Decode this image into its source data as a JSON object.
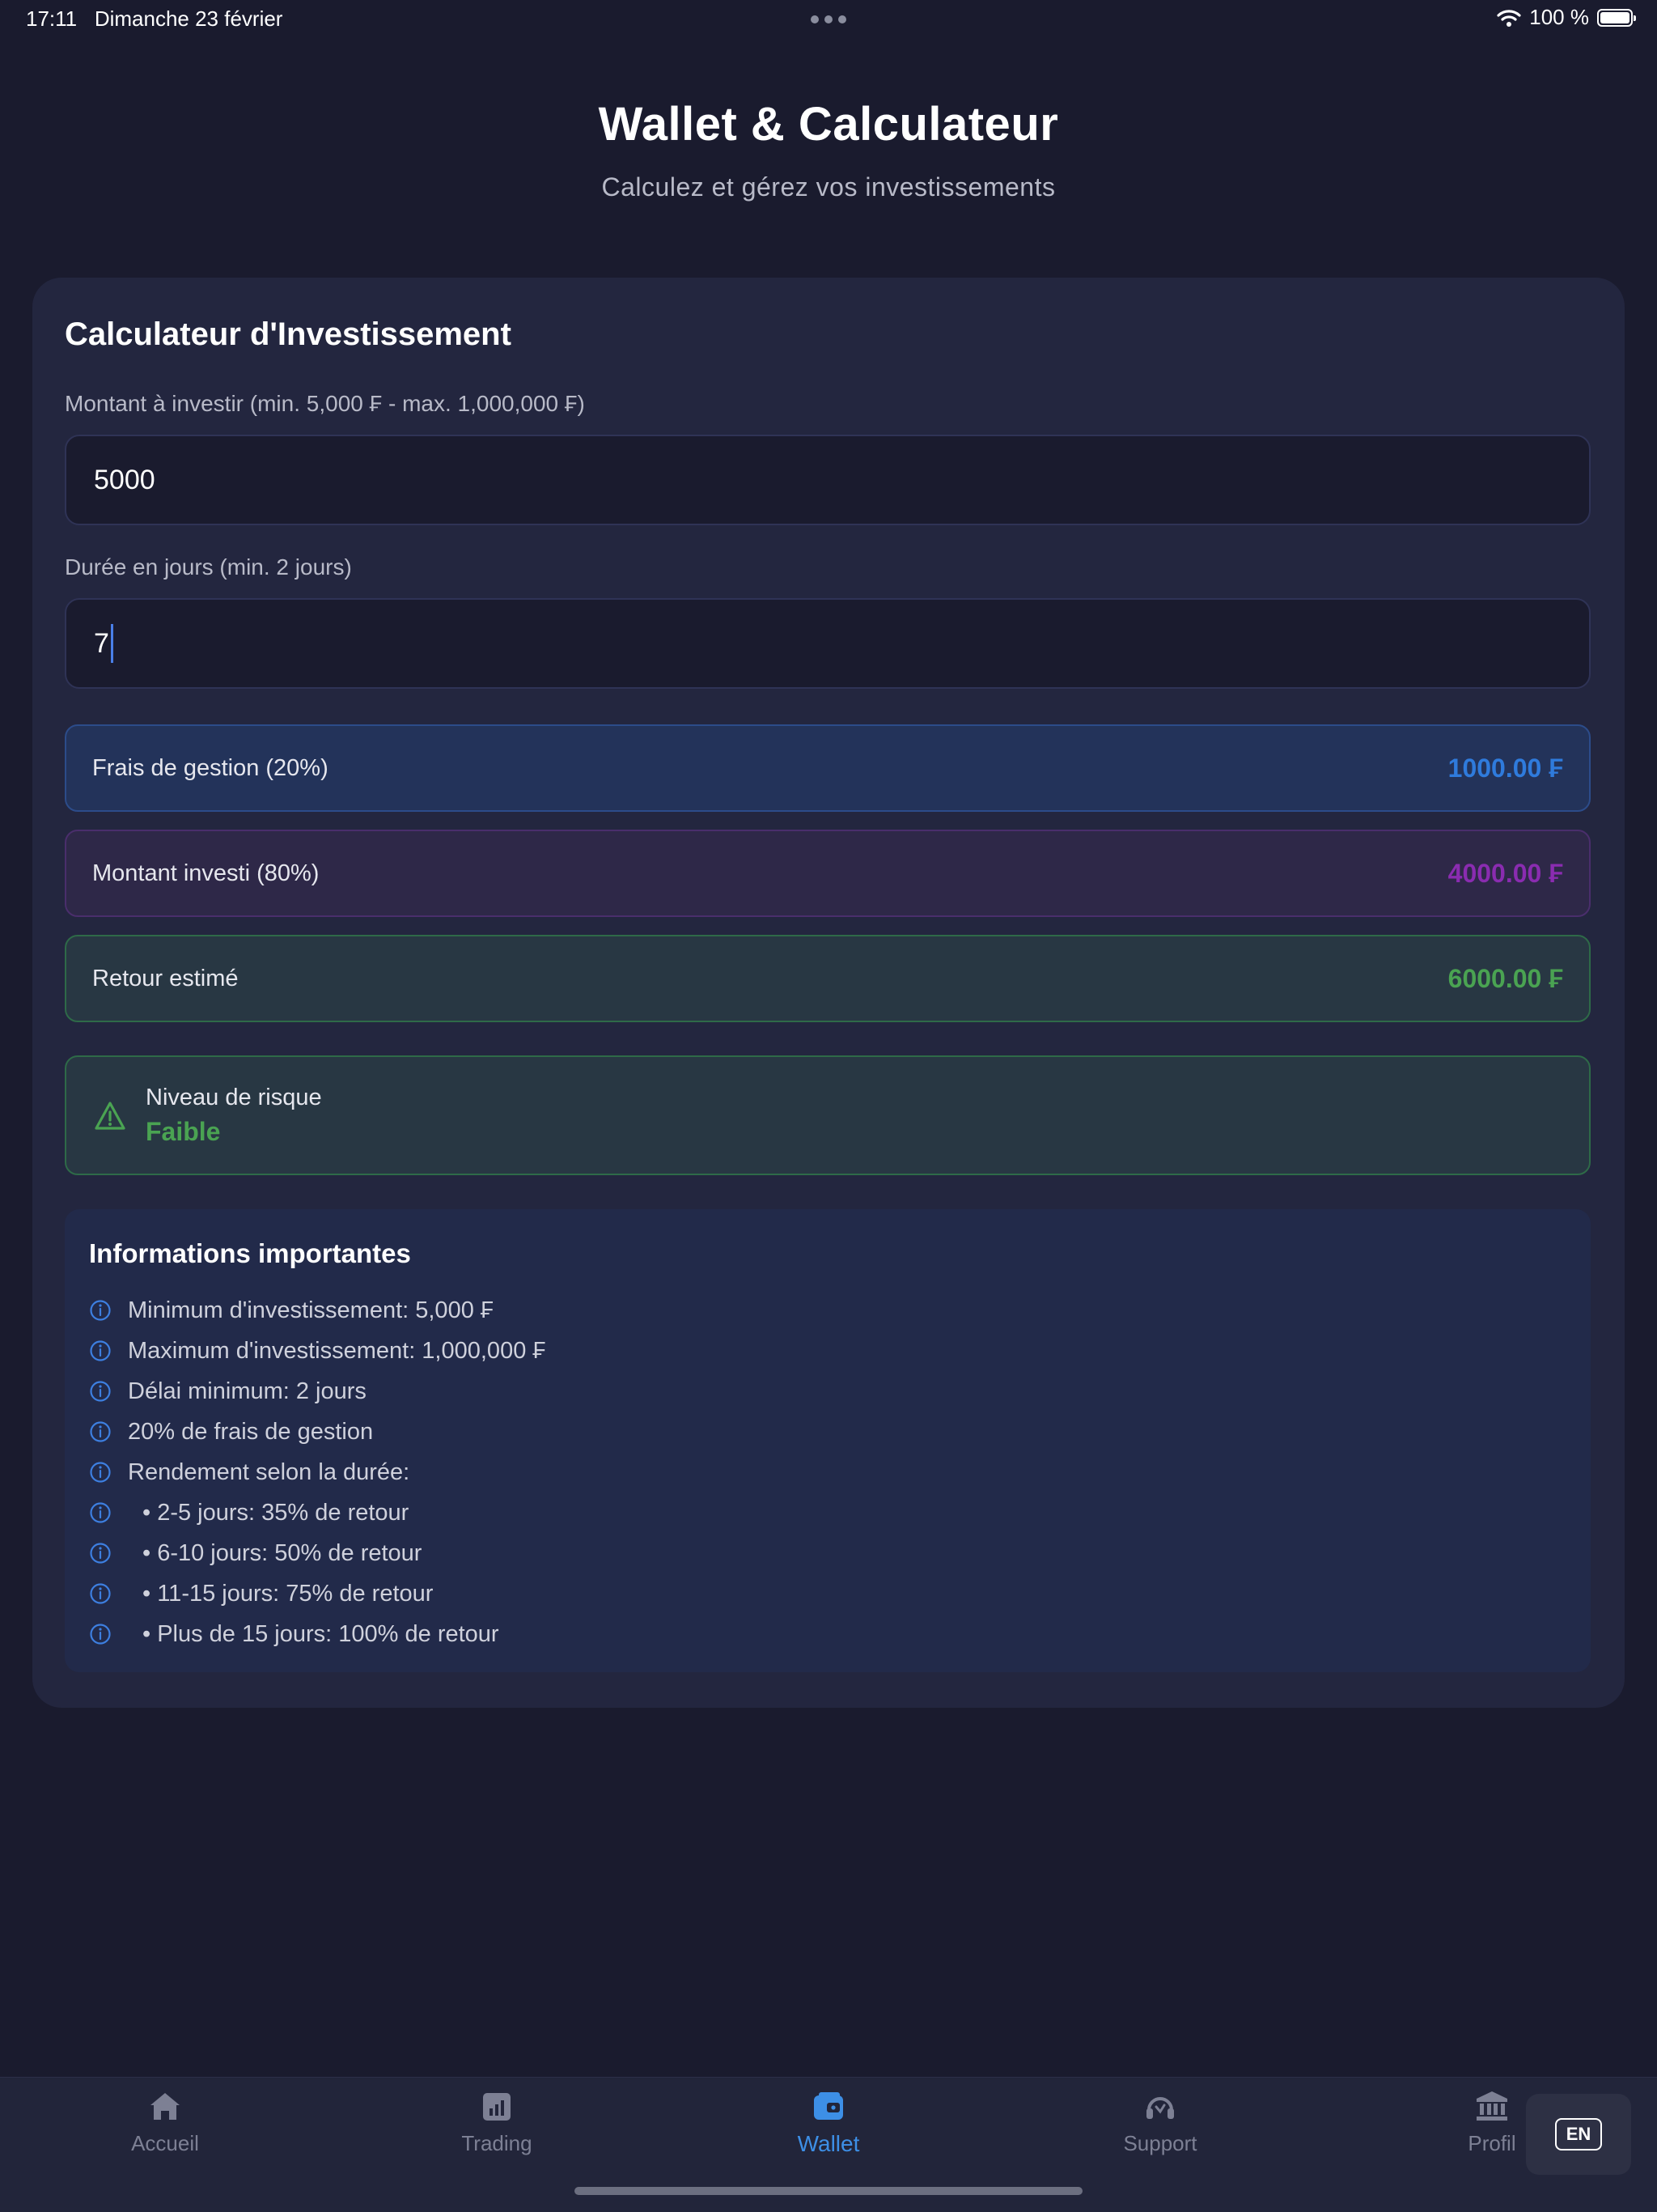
{
  "status_bar": {
    "time": "17:11",
    "date": "Dimanche 23 février",
    "battery": "100 %"
  },
  "header": {
    "title": "Wallet & Calculateur",
    "subtitle": "Calculez et gérez vos investissements"
  },
  "calculator": {
    "title": "Calculateur d'Investissement",
    "amount_label": "Montant à investir (min. 5,000 ₣ - max. 1,000,000 ₣)",
    "amount_value": "5000",
    "duration_label": "Durée en jours (min. 2 jours)",
    "duration_value": "7",
    "fees_label": "Frais de gestion (20%)",
    "fees_value": "1000.00 ₣",
    "invested_label": "Montant investi (80%)",
    "invested_value": "4000.00 ₣",
    "return_label": "Retour estimé",
    "return_value": "6000.00 ₣",
    "risk_label": "Niveau de risque",
    "risk_value": "Faible"
  },
  "info": {
    "title": "Informations importantes",
    "items": [
      "Minimum d'investissement: 5,000 ₣",
      "Maximum d'investissement: 1,000,000 ₣",
      "Délai minimum: 2 jours",
      "20% de frais de gestion",
      "Rendement selon la durée:",
      "• 2-5 jours: 35% de retour",
      "• 6-10 jours: 50% de retour",
      "• 11-15 jours: 75% de retour",
      "• Plus de 15 jours: 100% de retour"
    ]
  },
  "tabs": [
    {
      "label": "Accueil",
      "icon": "home-icon"
    },
    {
      "label": "Trading",
      "icon": "chart-icon"
    },
    {
      "label": "Wallet",
      "icon": "wallet-icon",
      "active": true
    },
    {
      "label": "Support",
      "icon": "headset-icon"
    },
    {
      "label": "Profil",
      "icon": "bank-icon"
    }
  ],
  "language_button": "EN",
  "colors": {
    "background": "#1a1b2e",
    "card": "#23263f",
    "accent_blue": "#2f7bdc",
    "accent_purple": "#8a2cb0",
    "accent_green": "#4aa352",
    "active_tab": "#3d8fe6"
  }
}
